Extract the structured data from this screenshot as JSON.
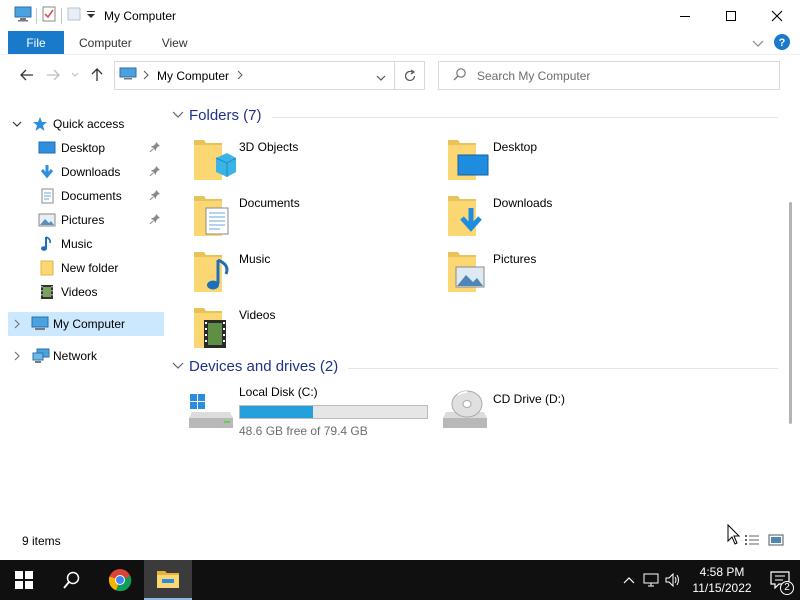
{
  "window": {
    "title": "My Computer",
    "minimize_glyph": "─",
    "maximize_glyph": "☐",
    "close_glyph": "✕"
  },
  "ribbon": {
    "tabs": [
      {
        "label": "File"
      },
      {
        "label": "Computer"
      },
      {
        "label": "View"
      }
    ],
    "expand_icon": "chevron-down-icon",
    "help_icon": "help-icon"
  },
  "address": {
    "crumb": "My Computer",
    "search_placeholder": "Search My Computer"
  },
  "nav": {
    "quick_access": "Quick access",
    "quick_items": [
      {
        "label": "Desktop",
        "icon": "desktop-icon",
        "pinned": true
      },
      {
        "label": "Downloads",
        "icon": "downloads-icon",
        "pinned": true
      },
      {
        "label": "Documents",
        "icon": "documents-icon",
        "pinned": true
      },
      {
        "label": "Pictures",
        "icon": "pictures-icon",
        "pinned": true
      },
      {
        "label": "Music",
        "icon": "music-icon",
        "pinned": false
      },
      {
        "label": "New folder",
        "icon": "folder-icon",
        "pinned": false
      },
      {
        "label": "Videos",
        "icon": "videos-icon",
        "pinned": false
      }
    ],
    "my_computer": "My Computer",
    "network": "Network"
  },
  "content": {
    "folders_header": "Folders (7)",
    "folders": [
      {
        "label": "3D Objects",
        "icon": "3d-objects-icon"
      },
      {
        "label": "Desktop",
        "icon": "desktop-folder-icon"
      },
      {
        "label": "Documents",
        "icon": "documents-folder-icon"
      },
      {
        "label": "Downloads",
        "icon": "downloads-folder-icon"
      },
      {
        "label": "Music",
        "icon": "music-folder-icon"
      },
      {
        "label": "Pictures",
        "icon": "pictures-folder-icon"
      },
      {
        "label": "Videos",
        "icon": "videos-folder-icon"
      }
    ],
    "drives_header": "Devices and drives (2)",
    "drives": [
      {
        "label": "Local Disk (C:)",
        "free": "48.6 GB free of 79.4 GB",
        "used_fraction": 0.388,
        "icon": "local-disk-icon"
      },
      {
        "label": "CD Drive (D:)",
        "icon": "cd-drive-icon"
      }
    ]
  },
  "status": {
    "item_count": "9 items"
  },
  "taskbar": {
    "time": "4:58 PM",
    "date": "11/15/2022",
    "notification_count": "2",
    "accent": "#1979ca"
  }
}
